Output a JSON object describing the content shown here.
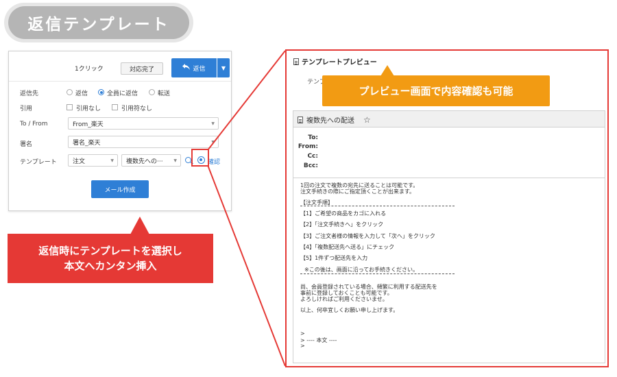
{
  "banner": {
    "title": "返信テンプレート"
  },
  "compose": {
    "one_click": "1クリック",
    "done_button": "対応完了",
    "reply_button": "返信",
    "reply_icon": "reply-arrow-icon",
    "rows": {
      "recipient_label": "返信先",
      "recipient_options": [
        "返信",
        "全員に返信",
        "転送"
      ],
      "recipient_selected": "全員に返信",
      "quote_label": "引用",
      "quote_options": [
        "引用なし",
        "引用符なし"
      ],
      "to_from_label": "To / From",
      "to_from_value": "From_楽天",
      "signature_label": "署名",
      "signature_value": "署名_楽天",
      "template_label": "テンプレート",
      "template_category": "注文",
      "template_value": "複数先への···",
      "preview_link": "確認"
    },
    "mail_button": "メール作成"
  },
  "callouts": {
    "red_line1": "返信時にテンプレートを選択し",
    "red_line2": "本文へカンタン挿入",
    "orange": "プレビュー画面で内容確認も可能"
  },
  "preview": {
    "title": "テンプレートプレビュー",
    "template_label": "テンプ",
    "subject": "複数先への配送",
    "headers": [
      "To:",
      "From:",
      "Cc:",
      "Bcc:"
    ],
    "body": [
      "1回の注文で複数の宛先に送ることは可能です。",
      "注文手続きの際にご指定頂くことが出来ます。",
      "【注文手順】",
      "【1】ご希望の商品をカゴに入れる",
      "【2】「注文手続きへ」をクリック",
      "【3】ご注文者様の情報を入力して「次へ」をクリック",
      "【4】「複数配送先へ送る」にチェック",
      "【5】1件ずつ配送先を入力",
      "※この後は、画面に沿ってお手続きください。",
      "尚、会員登録されている場合、頻繁に利用する配送先を",
      "事前に登録しておくことも可能です。",
      "よろしければご利用くださいませ。",
      "以上、何卒宜しくお願い申し上げます。",
      ">",
      "> ---- 本文 ----",
      ">"
    ]
  },
  "colors": {
    "accent_blue": "#2f7fd6",
    "highlight_red": "#e53935",
    "badge_orange": "#f29b13"
  }
}
